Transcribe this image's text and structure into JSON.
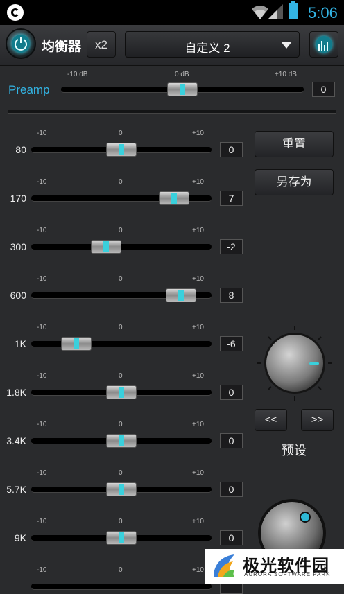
{
  "status_bar": {
    "time": "5:06",
    "battery_color": "#33b5e5"
  },
  "toolbar": {
    "title": "均衡器",
    "x2_label": "x2",
    "preset_value": "自定义 2",
    "accent": "#33b5e5"
  },
  "preamp": {
    "label": "Preamp",
    "min_label": "-10 dB",
    "mid_label": "0 dB",
    "max_label": "+10 dB",
    "value": "0"
  },
  "band_scale": {
    "min": "-10",
    "mid": "0",
    "max": "+10"
  },
  "bands": [
    {
      "freq": "80",
      "value": "0"
    },
    {
      "freq": "170",
      "value": "7"
    },
    {
      "freq": "300",
      "value": "-2"
    },
    {
      "freq": "600",
      "value": "8"
    },
    {
      "freq": "1K",
      "value": "-6"
    },
    {
      "freq": "1.8K",
      "value": "0"
    },
    {
      "freq": "3.4K",
      "value": "0"
    },
    {
      "freq": "5.7K",
      "value": "0"
    },
    {
      "freq": "9K",
      "value": "0"
    },
    {
      "freq": "",
      "value": ""
    }
  ],
  "side_panel": {
    "reset_label": "重置",
    "save_as_label": "另存为",
    "prev_label": "<<",
    "next_label": ">>",
    "presets_label": "预设"
  },
  "watermark": {
    "name": "极光软件园",
    "sub": "AURORA SOFTWARE PARK"
  }
}
